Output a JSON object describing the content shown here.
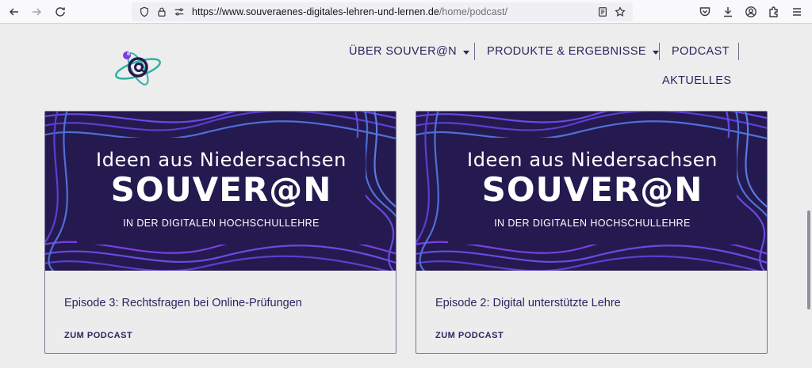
{
  "browser": {
    "url_host": "https://www.souveraenes-digitales-lehren-und-lernen.de",
    "url_path": "/home/podcast/"
  },
  "nav": {
    "items": [
      {
        "label": "ÜBER SOUVER@N"
      },
      {
        "label": "PRODUKTE & ERGEBNISSE"
      },
      {
        "label": "PODCAST"
      },
      {
        "label": "AKTUELLES"
      }
    ]
  },
  "cards": [
    {
      "image": {
        "line1": "Ideen aus Niedersachsen",
        "line2": "SOUVER@N",
        "line3": "IN DER DIGITALEN HOCHSCHULLEHRE"
      },
      "title": "Episode 3: Rechtsfragen bei Online-Prüfungen",
      "link": "ZUM PODCAST"
    },
    {
      "image": {
        "line1": "Ideen aus Niedersachsen",
        "line2": "SOUVER@N",
        "line3": "IN DER DIGITALEN HOCHSCHULLEHRE"
      },
      "title": "Episode 2: Digital unterstützte Lehre",
      "link": "ZUM PODCAST"
    }
  ],
  "colors": {
    "brand_dark": "#241a4f",
    "text_primary": "#2c2461",
    "wave_blue": "#4f6fd8",
    "wave_purple": "#7b3fe0",
    "logo_teal": "#2bb3a3"
  }
}
